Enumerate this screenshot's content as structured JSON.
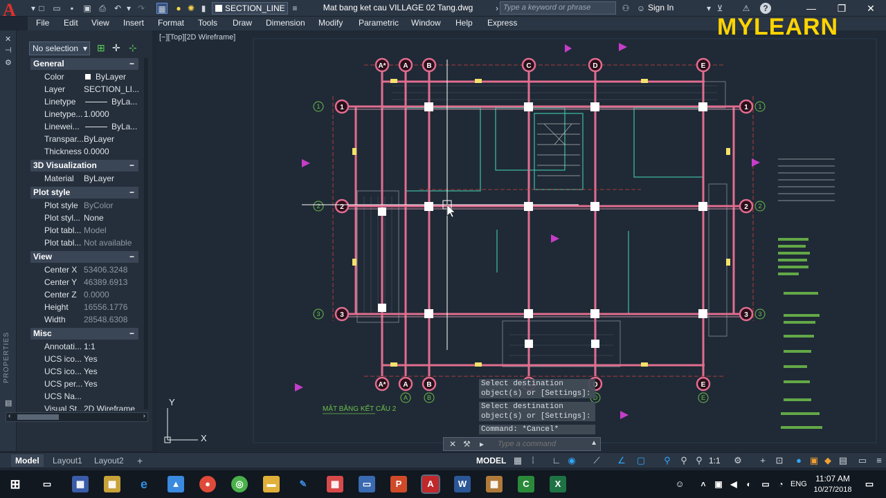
{
  "titlebar": {
    "layer_name": "SECTION_LINE",
    "document_title": "Mat bang ket cau  VILLAGE 02 Tang.dwg",
    "search_placeholder": "Type a keyword or phrase",
    "sign_in": "Sign In",
    "help": "?"
  },
  "watermark": "MYLEARN",
  "menu": [
    "File",
    "Edit",
    "View",
    "Insert",
    "Format",
    "Tools",
    "Draw",
    "Dimension",
    "Modify",
    "Parametric",
    "Window",
    "Help",
    "Express"
  ],
  "palette": {
    "selection": "No selection",
    "vertical_label": "PROPERTIES",
    "sections": [
      {
        "title": "General",
        "rows": [
          {
            "k": "Color",
            "v": "ByLayer"
          },
          {
            "k": "Layer",
            "v": "SECTION_LI..."
          },
          {
            "k": "Linetype",
            "v": "ByLa..."
          },
          {
            "k": "Linetype...",
            "v": "1.0000"
          },
          {
            "k": "Linewei...",
            "v": "ByLa..."
          },
          {
            "k": "Transpar...",
            "v": "ByLayer"
          },
          {
            "k": "Thickness",
            "v": "0.0000"
          }
        ]
      },
      {
        "title": "3D Visualization",
        "rows": [
          {
            "k": "Material",
            "v": "ByLayer"
          }
        ]
      },
      {
        "title": "Plot style",
        "rows": [
          {
            "k": "Plot style",
            "v": "ByColor"
          },
          {
            "k": "Plot styl...",
            "v": "None"
          },
          {
            "k": "Plot tabl...",
            "v": "Model"
          },
          {
            "k": "Plot tabl...",
            "v": "Not available"
          }
        ]
      },
      {
        "title": "View",
        "rows": [
          {
            "k": "Center X",
            "v": "53406.3248"
          },
          {
            "k": "Center Y",
            "v": "46389.6913"
          },
          {
            "k": "Center Z",
            "v": "0.0000"
          },
          {
            "k": "Height",
            "v": "16556.1776"
          },
          {
            "k": "Width",
            "v": "28548.6308"
          }
        ]
      },
      {
        "title": "Misc",
        "rows": [
          {
            "k": "Annotati...",
            "v": "1:1"
          },
          {
            "k": "UCS ico...",
            "v": "Yes"
          },
          {
            "k": "UCS ico...",
            "v": "Yes"
          },
          {
            "k": "UCS per...",
            "v": "Yes"
          },
          {
            "k": "UCS Na...",
            "v": ""
          },
          {
            "k": "Visual St...",
            "v": "2D Wireframe"
          }
        ]
      }
    ]
  },
  "viewport": {
    "label": "[−][Top][2D Wireframe]",
    "drawing_title": "MẶT BẰNG KẾT CẤU 2",
    "ucs_x": "X",
    "ucs_y": "Y",
    "grid_top": [
      "A*",
      "A",
      "B",
      "C",
      "D",
      "E"
    ],
    "grid_side": [
      "1",
      "2",
      "3"
    ],
    "bottom_letters": [
      "A",
      "B",
      "D",
      "E"
    ]
  },
  "command": {
    "history": [
      "Select destination object(s) or [Settings]:",
      "Select destination object(s) or [Settings]:",
      "Command: *Cancel*"
    ],
    "placeholder": "Type a command"
  },
  "tabs": [
    "Model",
    "Layout1",
    "Layout2"
  ],
  "status": {
    "mode": "MODEL",
    "scale": "1:1"
  },
  "taskbar": {
    "time": "11:07 AM",
    "date": "10/27/2018",
    "language": "ENG"
  }
}
